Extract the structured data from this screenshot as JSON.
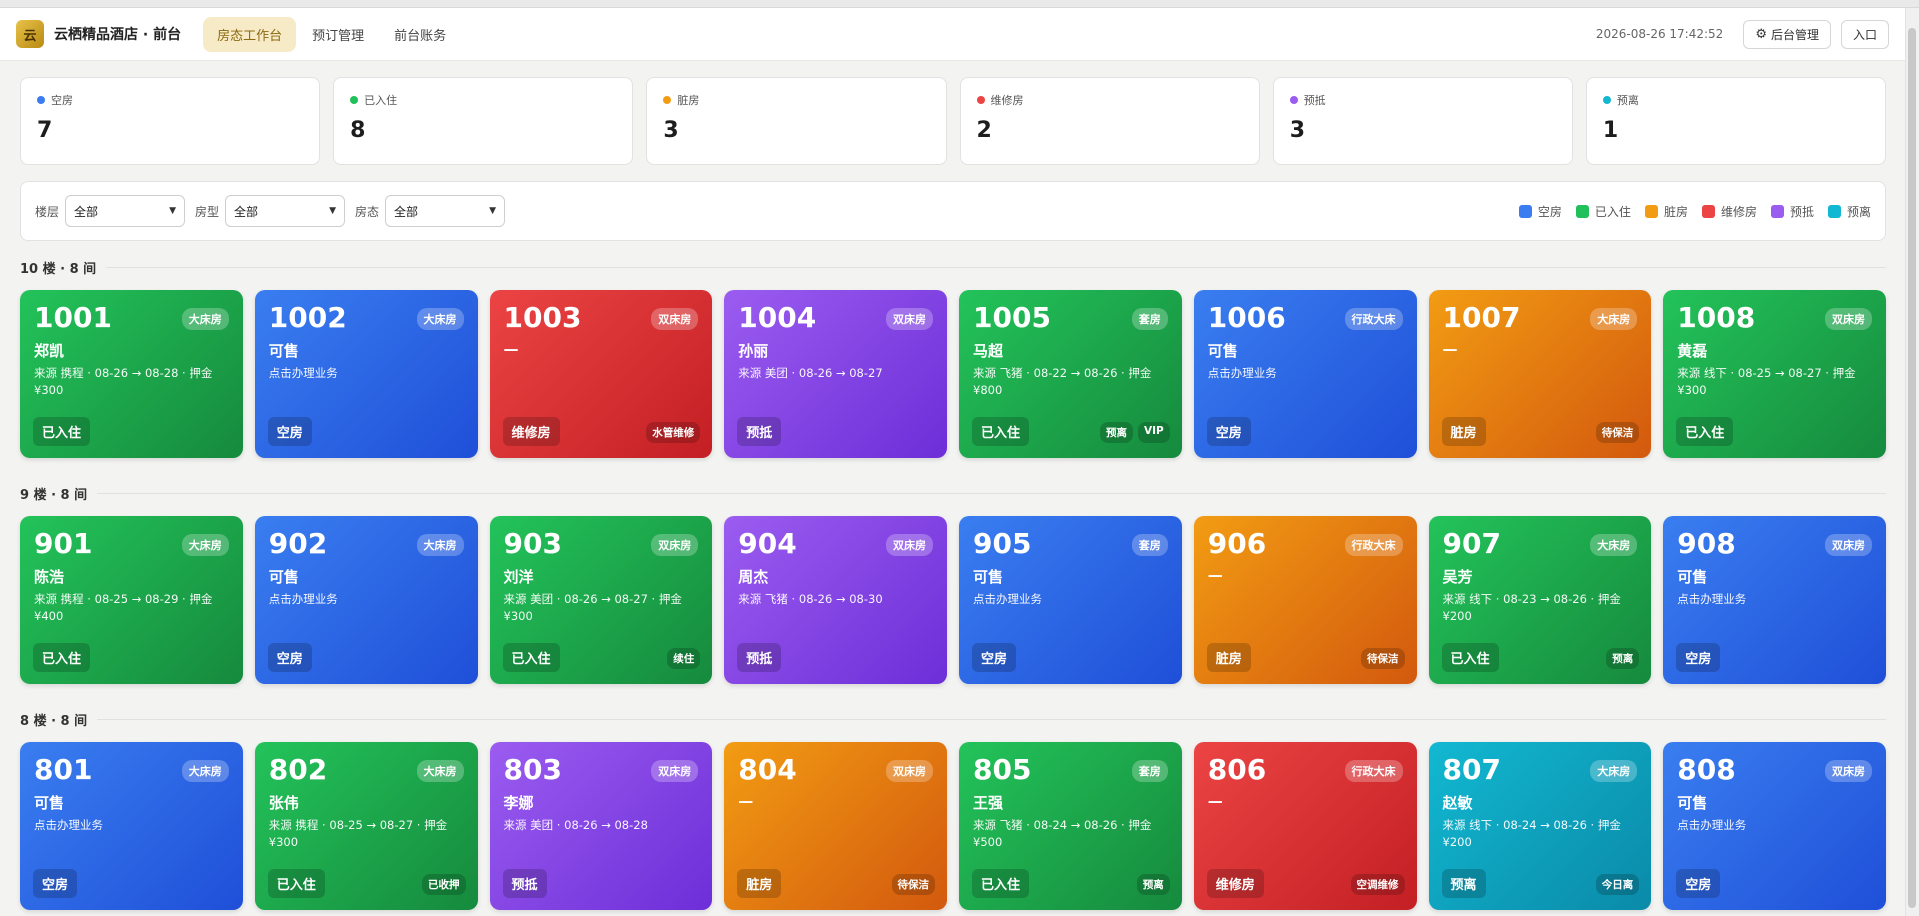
{
  "header": {
    "logo_text": "云",
    "brand": "云栖精品酒店 · 前台",
    "tabs": [
      {
        "label": "房态工作台",
        "active": true
      },
      {
        "label": "预订管理",
        "active": false
      },
      {
        "label": "前台账务",
        "active": false
      }
    ],
    "datetime": "2026-08-26 17:42:52",
    "admin_button": "后台管理",
    "entry_button": "入口"
  },
  "stats": [
    {
      "label": "空房",
      "value": "7",
      "color": "#3b7cf0"
    },
    {
      "label": "已入住",
      "value": "8",
      "color": "#22c05a"
    },
    {
      "label": "脏房",
      "value": "3",
      "color": "#f29c13"
    },
    {
      "label": "维修房",
      "value": "2",
      "color": "#ec4444"
    },
    {
      "label": "预抵",
      "value": "3",
      "color": "#9b5cf0"
    },
    {
      "label": "预离",
      "value": "1",
      "color": "#12b8d1"
    }
  ],
  "filters": {
    "floor_label": "楼层",
    "floor_value": "全部",
    "type_label": "房型",
    "type_value": "全部",
    "status_label": "房态",
    "status_value": "全部"
  },
  "legend": [
    {
      "label": "空房",
      "color": "#3b7cf0"
    },
    {
      "label": "已入住",
      "color": "#22c05a"
    },
    {
      "label": "脏房",
      "color": "#f29c13"
    },
    {
      "label": "维修房",
      "color": "#ec4444"
    },
    {
      "label": "预抵",
      "color": "#9b5cf0"
    },
    {
      "label": "预离",
      "color": "#12b8d1"
    }
  ],
  "floors": [
    {
      "title": "10 楼 · 8 间",
      "rooms": [
        {
          "no": "1001",
          "type": "大床房",
          "guest": "郑凯",
          "detail": "来源 携程 · 08-26 → 08-28 · 押金 ¥300",
          "status": "已入住",
          "state": "occupied",
          "badges": []
        },
        {
          "no": "1002",
          "type": "大床房",
          "guest": "可售",
          "detail": "点击办理业务",
          "status": "空房",
          "state": "vacant",
          "badges": []
        },
        {
          "no": "1003",
          "type": "双床房",
          "guest": "—",
          "detail": "",
          "status": "维修房",
          "state": "repair",
          "badges": [
            "水管维修"
          ]
        },
        {
          "no": "1004",
          "type": "双床房",
          "guest": "孙丽",
          "detail": "来源 美团 · 08-26 → 08-27",
          "status": "预抵",
          "state": "reserved",
          "badges": []
        },
        {
          "no": "1005",
          "type": "套房",
          "guest": "马超",
          "detail": "来源 飞猪 · 08-22 → 08-26 · 押金 ¥800",
          "status": "已入住",
          "state": "occupied",
          "badges": [
            "预离",
            "VIP"
          ]
        },
        {
          "no": "1006",
          "type": "行政大床",
          "guest": "可售",
          "detail": "点击办理业务",
          "status": "空房",
          "state": "vacant",
          "badges": []
        },
        {
          "no": "1007",
          "type": "大床房",
          "guest": "—",
          "detail": "",
          "status": "脏房",
          "state": "dirty",
          "badges": [
            "待保洁"
          ]
        },
        {
          "no": "1008",
          "type": "双床房",
          "guest": "黄磊",
          "detail": "来源 线下 · 08-25 → 08-27 · 押金 ¥300",
          "status": "已入住",
          "state": "occupied",
          "badges": []
        }
      ]
    },
    {
      "title": "9 楼 · 8 间",
      "rooms": [
        {
          "no": "901",
          "type": "大床房",
          "guest": "陈浩",
          "detail": "来源 携程 · 08-25 → 08-29 · 押金 ¥400",
          "status": "已入住",
          "state": "occupied",
          "badges": []
        },
        {
          "no": "902",
          "type": "大床房",
          "guest": "可售",
          "detail": "点击办理业务",
          "status": "空房",
          "state": "vacant",
          "badges": []
        },
        {
          "no": "903",
          "type": "双床房",
          "guest": "刘洋",
          "detail": "来源 美团 · 08-26 → 08-27 · 押金 ¥300",
          "status": "已入住",
          "state": "occupied",
          "badges": [
            "续住"
          ]
        },
        {
          "no": "904",
          "type": "双床房",
          "guest": "周杰",
          "detail": "来源 飞猪 · 08-26 → 08-30",
          "status": "预抵",
          "state": "reserved",
          "badges": []
        },
        {
          "no": "905",
          "type": "套房",
          "guest": "可售",
          "detail": "点击办理业务",
          "status": "空房",
          "state": "vacant",
          "badges": []
        },
        {
          "no": "906",
          "type": "行政大床",
          "guest": "—",
          "detail": "",
          "status": "脏房",
          "state": "dirty",
          "badges": [
            "待保洁"
          ]
        },
        {
          "no": "907",
          "type": "大床房",
          "guest": "吴芳",
          "detail": "来源 线下 · 08-23 → 08-26 · 押金 ¥200",
          "status": "已入住",
          "state": "occupied",
          "badges": [
            "预离"
          ]
        },
        {
          "no": "908",
          "type": "双床房",
          "guest": "可售",
          "detail": "点击办理业务",
          "status": "空房",
          "state": "vacant",
          "badges": []
        }
      ]
    },
    {
      "title": "8 楼 · 8 间",
      "rooms": [
        {
          "no": "801",
          "type": "大床房",
          "guest": "可售",
          "detail": "点击办理业务",
          "status": "空房",
          "state": "vacant",
          "badges": []
        },
        {
          "no": "802",
          "type": "大床房",
          "guest": "张伟",
          "detail": "来源 携程 · 08-25 → 08-27 · 押金 ¥300",
          "status": "已入住",
          "state": "occupied",
          "badges": [
            "已收押"
          ]
        },
        {
          "no": "803",
          "type": "双床房",
          "guest": "李娜",
          "detail": "来源 美团 · 08-26 → 08-28",
          "status": "预抵",
          "state": "reserved",
          "badges": []
        },
        {
          "no": "804",
          "type": "双床房",
          "guest": "—",
          "detail": "",
          "status": "脏房",
          "state": "dirty",
          "badges": [
            "待保洁"
          ]
        },
        {
          "no": "805",
          "type": "套房",
          "guest": "王强",
          "detail": "来源 飞猪 · 08-24 → 08-26 · 押金 ¥500",
          "status": "已入住",
          "state": "occupied",
          "badges": [
            "预离"
          ]
        },
        {
          "no": "806",
          "type": "行政大床",
          "guest": "—",
          "detail": "",
          "status": "维修房",
          "state": "repair",
          "badges": [
            "空调维修"
          ]
        },
        {
          "no": "807",
          "type": "大床房",
          "guest": "赵敏",
          "detail": "来源 线下 · 08-24 → 08-26 · 押金 ¥200",
          "status": "预离",
          "state": "departing",
          "badges": [
            "今日离"
          ]
        },
        {
          "no": "808",
          "type": "双床房",
          "guest": "可售",
          "detail": "点击办理业务",
          "status": "空房",
          "state": "vacant",
          "badges": []
        }
      ]
    }
  ]
}
